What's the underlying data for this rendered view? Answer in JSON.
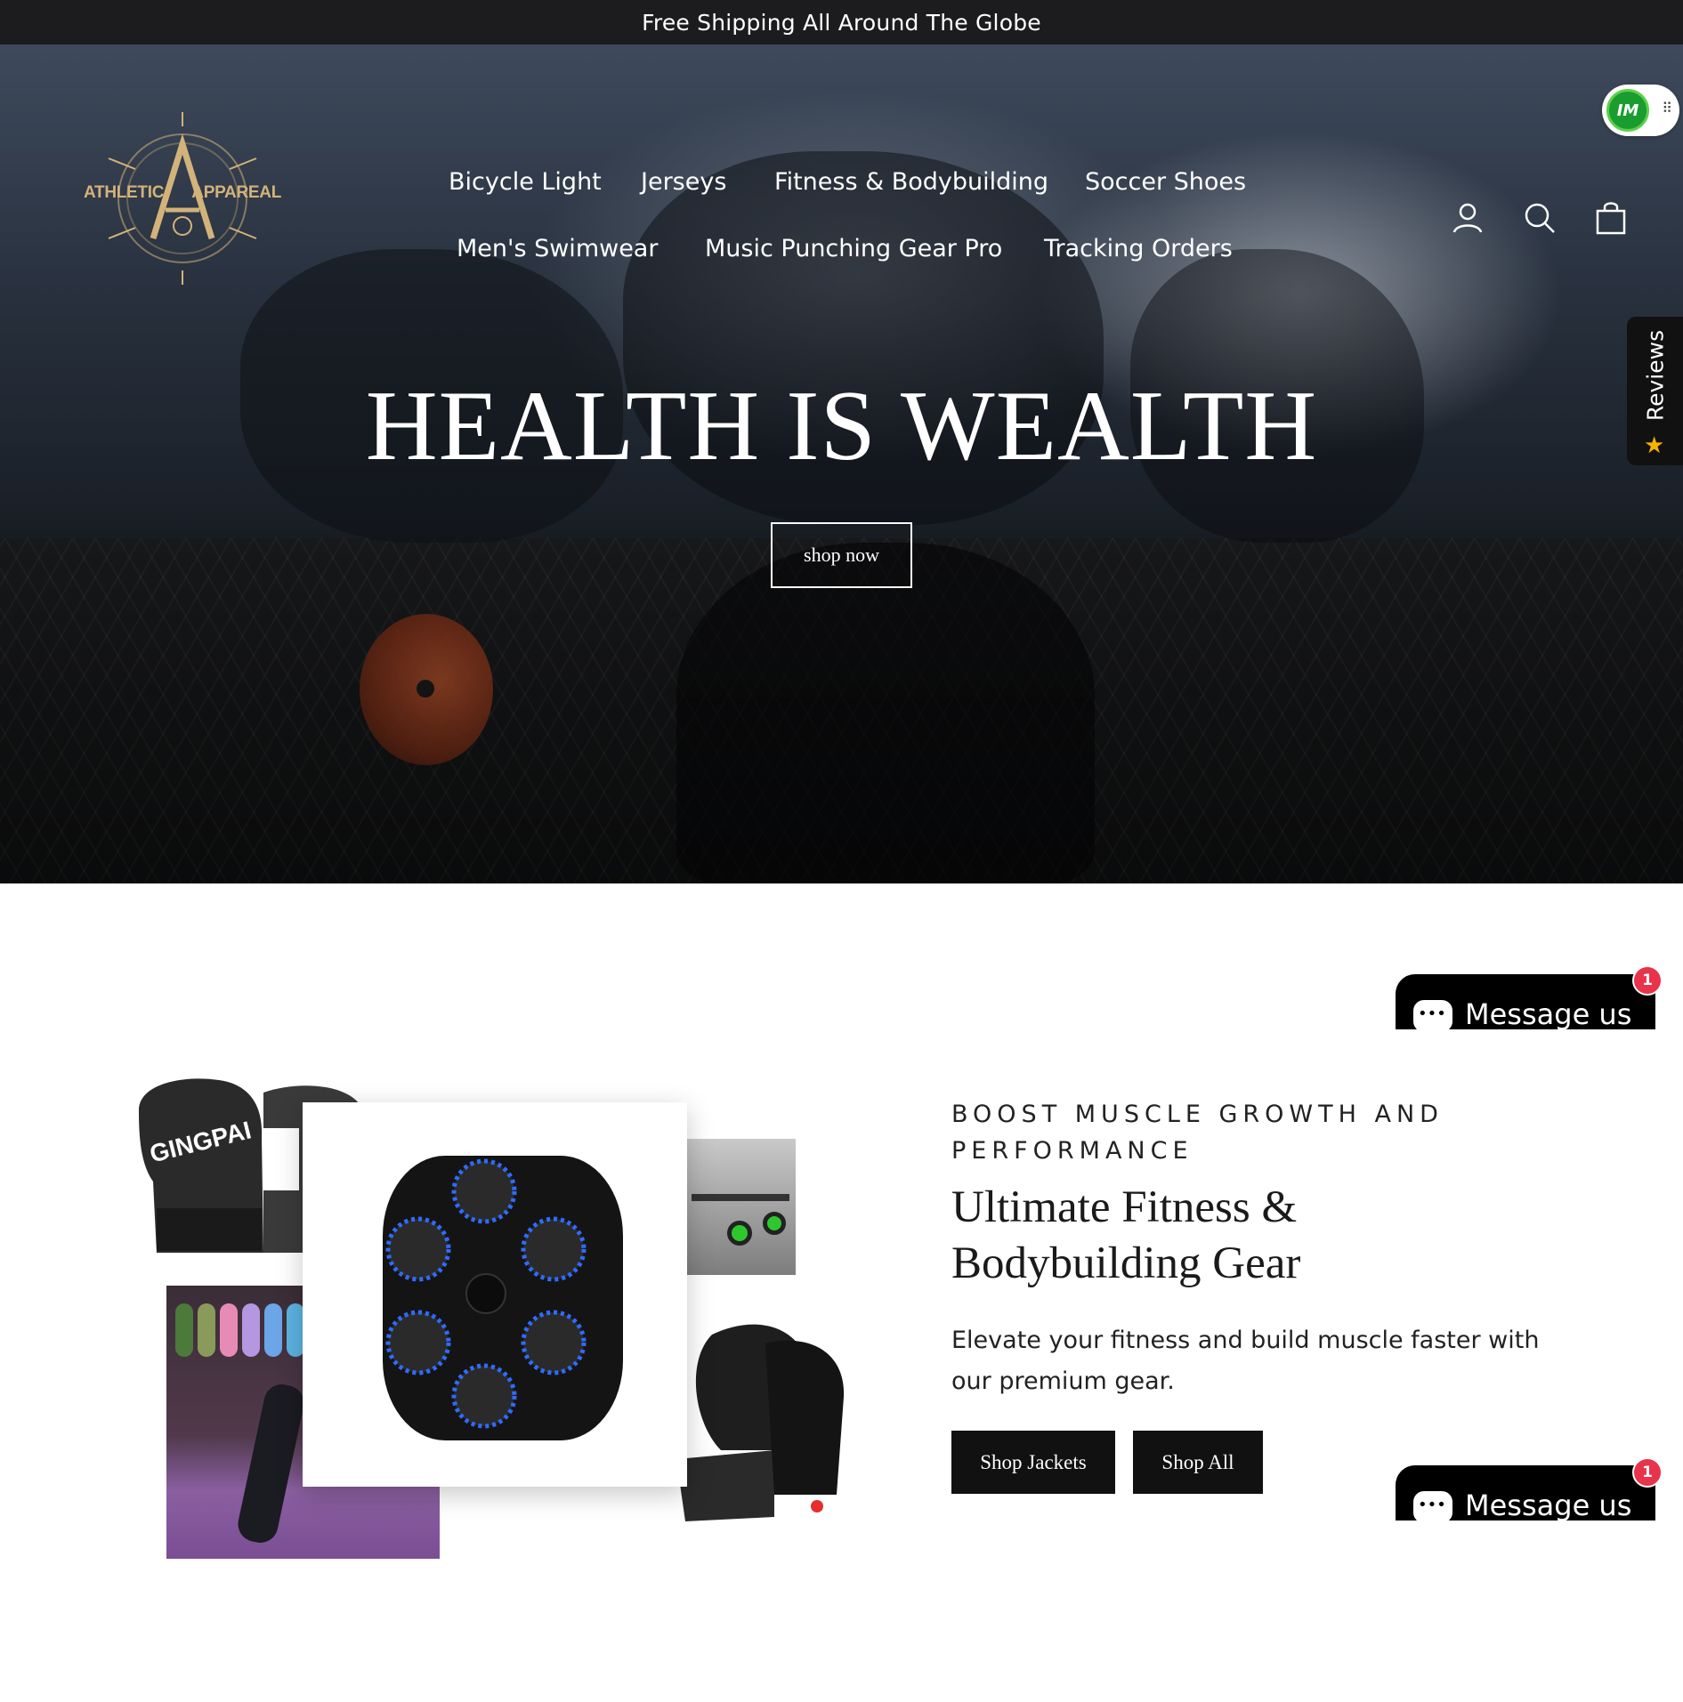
{
  "announcement": {
    "text": "Free Shipping All Around The Globe"
  },
  "brand": {
    "name_left": "ATHLETIC",
    "name_right": "APPAREAL",
    "logo_color": "#d3b37a"
  },
  "nav": {
    "items": [
      "Bicycle Light",
      "Jerseys",
      "Fitness & Bodybuilding",
      "Soccer Shoes",
      "Men's Swimwear",
      "Music Punching Gear Pro",
      "Tracking Orders"
    ]
  },
  "header_icons": [
    "account-icon",
    "search-icon",
    "cart-icon"
  ],
  "hero": {
    "title": "HEALTH IS WEALTH",
    "cta_label": "shop now"
  },
  "widgets": {
    "im_badge_label": "IM",
    "reviews_label": "Reviews",
    "message_label": "Message us",
    "message_count": "1"
  },
  "feature": {
    "subheading": "BOOST MUSCLE GROWTH AND PERFORMANCE",
    "title": "Ultimate Fitness & Bodybuilding Gear",
    "description": "Elevate your fitness and build muscle faster with our premium gear.",
    "buttons": [
      "Shop Jackets",
      "Shop All"
    ],
    "glove_brand": "GINGPAI"
  },
  "colors": {
    "announcement_bg": "#1c1c1e",
    "button_bg": "#111111",
    "badge_red": "#e8334a",
    "im_green": "#1a9d2e",
    "punch_pad_blue": "#2f6bff"
  }
}
